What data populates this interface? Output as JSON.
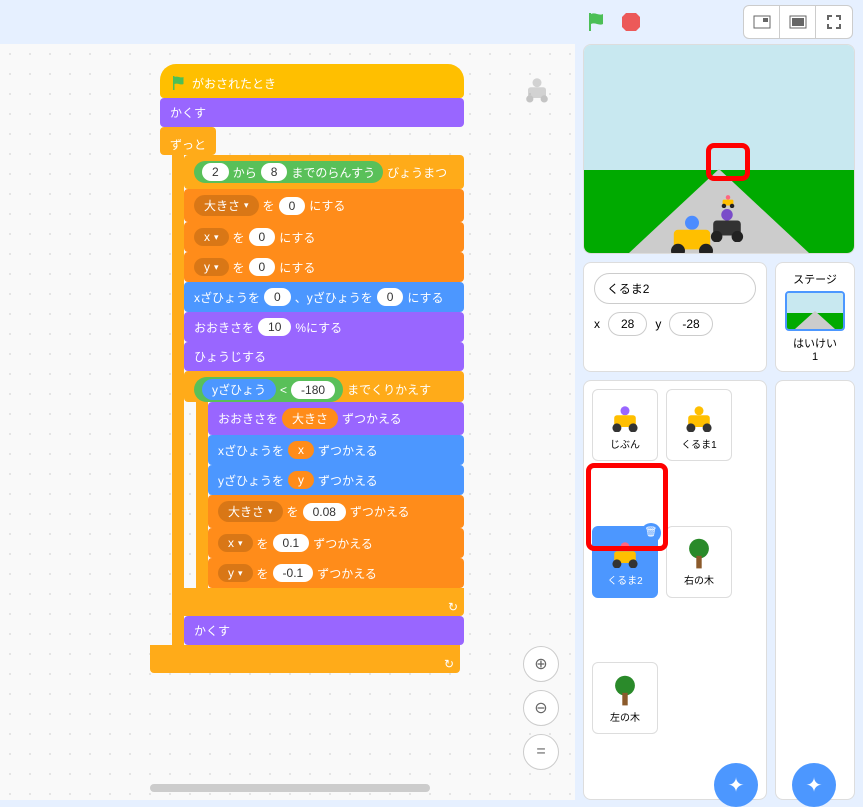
{
  "topbar": {
    "flag": "green-flag",
    "stop": "stop-sign"
  },
  "blocks": {
    "when_flag": "がおされたとき",
    "hide1": "かくす",
    "forever": "ずっと",
    "rand_from": "から",
    "rand_to": "までのらんすう",
    "rand_val1": "2",
    "rand_val2": "8",
    "wait_sec": "びょうまつ",
    "size_var": "大きさ",
    "set_to": "を",
    "set_suffix": "にする",
    "zero": "0",
    "x_var": "x",
    "y_var": "y",
    "goto_x": "xざひょうを",
    "goto_y": "、yざひょうを",
    "setsize": "おおきさを",
    "setsize_val": "10",
    "percent": "%にする",
    "show": "ひょうじする",
    "repeat_until": "までくりかえす",
    "ypos": "yざひょう",
    "lt": "<",
    "neg180": "-180",
    "changesize": "おおきさを",
    "change_by": "ずつかえる",
    "changex": "xざひょうを",
    "changey": "yざひょうを",
    "val008": "0.08",
    "val01": "0.1",
    "valneg01": "-0.1",
    "hide2": "かくす"
  },
  "sprite_info": {
    "name": "くるま2",
    "x_label": "x",
    "x_val": "28",
    "y_label": "y",
    "y_val": "-28"
  },
  "stage_panel": {
    "title": "ステージ",
    "backdrop_label": "はいけい",
    "count": "1"
  },
  "sprites": [
    {
      "name": "じぶん",
      "type": "car",
      "color": "#9966ff"
    },
    {
      "name": "くるま1",
      "type": "car",
      "color": "#ffbf00"
    },
    {
      "name": "くるま2",
      "type": "car",
      "color": "#ff6680",
      "selected": true
    },
    {
      "name": "右の木",
      "type": "tree"
    },
    {
      "name": "左の木",
      "type": "tree"
    }
  ]
}
